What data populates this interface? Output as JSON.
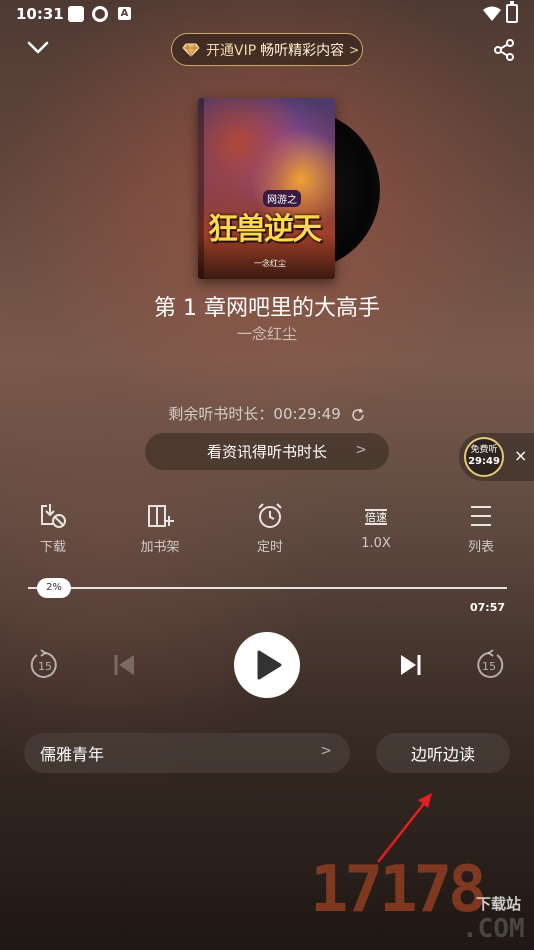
{
  "status_bar": {
    "time": "10:31",
    "a_icon": "A"
  },
  "header": {
    "vip_text_1": "开通VIP",
    "vip_text_2": "畅听精彩内容",
    "vip_arrow": ">"
  },
  "book": {
    "cover_subtitle": "网游之",
    "cover_title": "狂兽逆天",
    "cover_author": "一念红尘",
    "chapter_title": "第 1 章网吧里的大高手",
    "author": "一念红尘"
  },
  "listen": {
    "remaining_label": "剩余听书时长：",
    "remaining_time": "00:29:49",
    "earn_button": "看资讯得听书时长",
    "earn_arrow": ">"
  },
  "free_widget": {
    "label": "免费听",
    "time": "29:49",
    "close": "×"
  },
  "functions": [
    {
      "label": "下载",
      "icon": "download-icon"
    },
    {
      "label": "加书架",
      "icon": "add-bookshelf-icon"
    },
    {
      "label": "定时",
      "icon": "alarm-clock-icon"
    },
    {
      "label": "1.0X",
      "icon": "speed-icon",
      "icon_text": "倍速"
    },
    {
      "label": "列表",
      "icon": "list-icon"
    }
  ],
  "progress": {
    "percent_label": "2%",
    "percent": 2,
    "duration": "07:57"
  },
  "controls": {
    "rewind_seconds": "15",
    "forward_seconds": "15"
  },
  "voice": {
    "name": "儒雅青年",
    "arrow": ">"
  },
  "read_button": "边听边读",
  "watermark": {
    "main": "17178",
    "small": "下载站",
    "com": ".COM"
  },
  "colors": {
    "vip_gold": "#c9a86a",
    "annotation_red": "#e02020",
    "watermark_orange": "#c85028"
  }
}
